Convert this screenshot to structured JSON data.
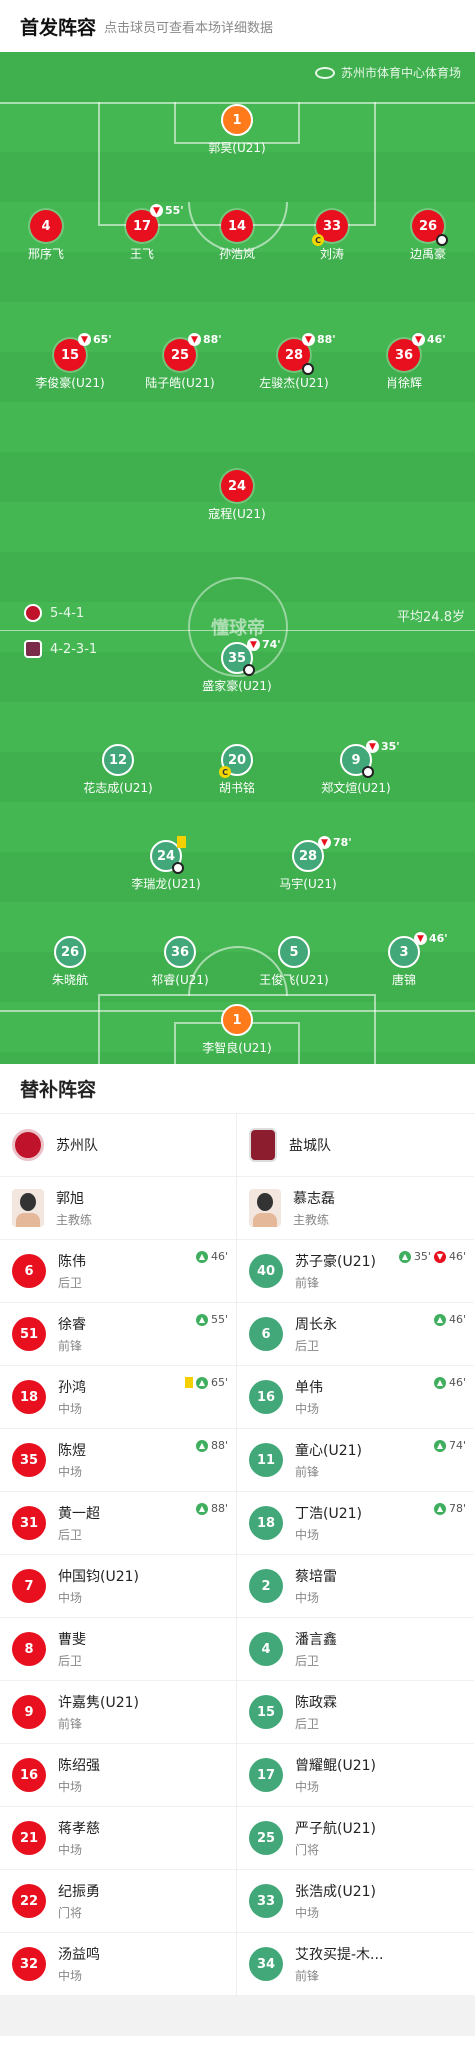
{
  "header": {
    "title": "首发阵容",
    "subtitle": "点击球员可查看本场详细数据"
  },
  "venue": "苏州市体育中心体育场",
  "home_formation": "5-4-1",
  "away_formation": "4-2-3-1",
  "avg_age": "平均24.8岁",
  "watermark": "懂球帝",
  "home_players": [
    {
      "num": "1",
      "name": "郭昊(U21)"
    },
    {
      "num": "4",
      "name": "邢序飞"
    },
    {
      "num": "17",
      "name": "王飞",
      "sub": "55'"
    },
    {
      "num": "14",
      "name": "孙浩岚"
    },
    {
      "num": "33",
      "name": "刘涛"
    },
    {
      "num": "26",
      "name": "边禹豪"
    },
    {
      "num": "15",
      "name": "李俊豪(U21)",
      "sub": "65'"
    },
    {
      "num": "25",
      "name": "陆子皓(U21)",
      "sub": "88'"
    },
    {
      "num": "28",
      "name": "左骏杰(U21)",
      "sub": "88'"
    },
    {
      "num": "36",
      "name": "肖徐辉",
      "sub": "46'"
    },
    {
      "num": "24",
      "name": "寇程(U21)"
    }
  ],
  "away_players": [
    {
      "num": "35",
      "name": "盛家豪(U21)",
      "sub": "74'"
    },
    {
      "num": "12",
      "name": "花志成(U21)"
    },
    {
      "num": "20",
      "name": "胡书铭"
    },
    {
      "num": "9",
      "name": "郑文煊(U21)",
      "sub": "35'"
    },
    {
      "num": "24",
      "name": "李瑞龙(U21)"
    },
    {
      "num": "28",
      "name": "马宇(U21)",
      "sub": "78'"
    },
    {
      "num": "26",
      "name": "朱晓航"
    },
    {
      "num": "36",
      "name": "祁睿(U21)"
    },
    {
      "num": "5",
      "name": "王俊飞(U21)"
    },
    {
      "num": "3",
      "name": "唐锦",
      "sub": "46'"
    },
    {
      "num": "1",
      "name": "李智良(U21)"
    }
  ],
  "subs_title": "替补阵容",
  "home_team": "苏州队",
  "away_team": "盐城队",
  "home_coach": {
    "name": "郭旭",
    "role": "主教练"
  },
  "away_coach": {
    "name": "慕志磊",
    "role": "主教练"
  },
  "home_subs": [
    {
      "num": "6",
      "name": "陈伟",
      "pos": "后卫",
      "ev": "46'"
    },
    {
      "num": "51",
      "name": "徐睿",
      "pos": "前锋",
      "ev": "55'"
    },
    {
      "num": "18",
      "name": "孙鸿",
      "pos": "中场",
      "ev": "65'"
    },
    {
      "num": "35",
      "name": "陈煜",
      "pos": "中场",
      "ev": "88'"
    },
    {
      "num": "31",
      "name": "黄一超",
      "pos": "后卫",
      "ev": "88'"
    },
    {
      "num": "7",
      "name": "仲国钧(U21)",
      "pos": "中场"
    },
    {
      "num": "8",
      "name": "曹斐",
      "pos": "后卫"
    },
    {
      "num": "9",
      "name": "许嘉隽(U21)",
      "pos": "前锋"
    },
    {
      "num": "16",
      "name": "陈绍强",
      "pos": "中场"
    },
    {
      "num": "21",
      "name": "蒋孝慈",
      "pos": "中场"
    },
    {
      "num": "22",
      "name": "纪振勇",
      "pos": "门将"
    },
    {
      "num": "32",
      "name": "汤益鸣",
      "pos": "中场"
    }
  ],
  "away_subs": [
    {
      "num": "40",
      "name": "苏子豪(U21)",
      "pos": "前锋",
      "ev": "35'",
      "ev2": "46'"
    },
    {
      "num": "6",
      "name": "周长永",
      "pos": "后卫",
      "ev": "46'"
    },
    {
      "num": "16",
      "name": "单伟",
      "pos": "中场",
      "ev": "46'"
    },
    {
      "num": "11",
      "name": "童心(U21)",
      "pos": "前锋",
      "ev": "74'"
    },
    {
      "num": "18",
      "name": "丁浩(U21)",
      "pos": "中场",
      "ev": "78'"
    },
    {
      "num": "2",
      "name": "蔡培雷",
      "pos": "中场"
    },
    {
      "num": "4",
      "name": "潘言鑫",
      "pos": "后卫"
    },
    {
      "num": "15",
      "name": "陈政霖",
      "pos": "后卫"
    },
    {
      "num": "17",
      "name": "曾耀鲲(U21)",
      "pos": "中场"
    },
    {
      "num": "25",
      "name": "严子航(U21)",
      "pos": "门将"
    },
    {
      "num": "33",
      "name": "张浩成(U21)",
      "pos": "中场"
    },
    {
      "num": "34",
      "name": "艾孜买提-木...",
      "pos": "前锋"
    }
  ],
  "colors": {
    "pitch": "#3fb04d",
    "home": "#e8101e",
    "away": "#43a879",
    "gk": "#ff7a1a"
  }
}
